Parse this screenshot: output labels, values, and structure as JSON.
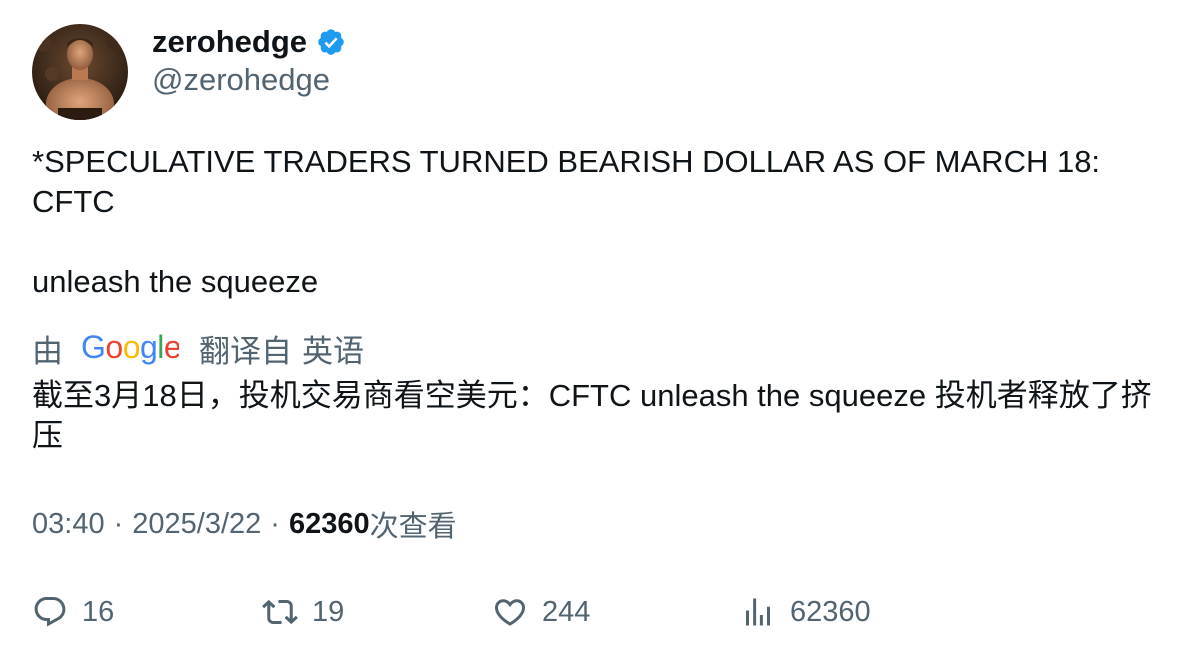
{
  "author": {
    "display_name": "zerohedge",
    "handle": "@zerohedge",
    "verified": true,
    "avatar_icon": "avatar-photo"
  },
  "tweet": {
    "line1": "*SPECULATIVE TRADERS TURNED BEARISH DOLLAR AS OF MARCH 18: CFTC",
    "line2": "unleash the squeeze"
  },
  "translation": {
    "prefix": "由",
    "provider": "Google",
    "label": "翻译自",
    "language": "英语",
    "text": "截至3月18日，投机交易商看空美元：CFTC unleash the squeeze 投机者释放了挤压"
  },
  "meta": {
    "time": "03:40",
    "date": "2025/3/22",
    "separator": "·",
    "views_count": "62360",
    "views_label": "次查看"
  },
  "actions": {
    "replies": "16",
    "retweets": "19",
    "likes": "244",
    "views": "62360"
  },
  "colors": {
    "text": "#0f1419",
    "secondary": "#536471",
    "verified_blue": "#1d9bf0"
  }
}
